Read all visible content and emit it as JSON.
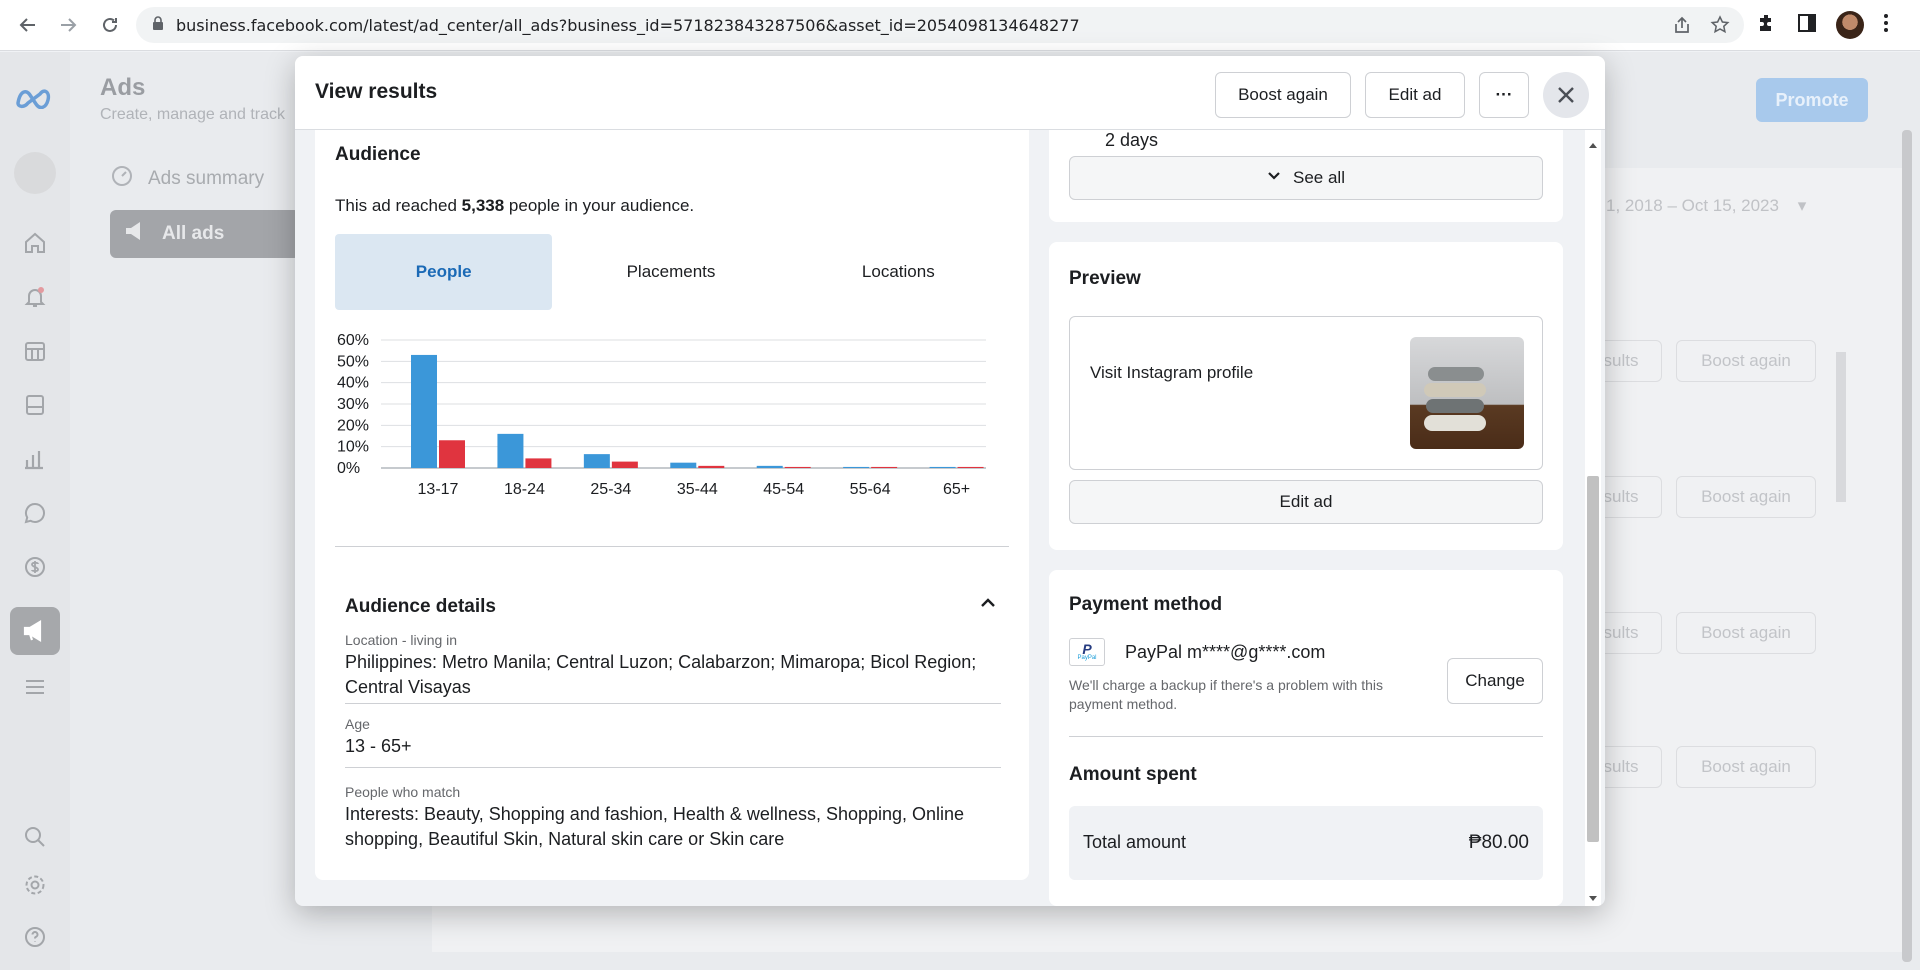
{
  "browser": {
    "url": "business.facebook.com/latest/ad_center/all_ads?business_id=571823843287506&asset_id=2054098134648277"
  },
  "background": {
    "title": "Ads",
    "subtitle": "Create, manage and track",
    "menu": [
      {
        "label": "Ads summary"
      },
      {
        "label": "All ads"
      }
    ],
    "promote_label": "Promote",
    "date_range": "1, 2018 – Oct 15, 2023",
    "row_buttons": [
      "sults",
      "Boost again"
    ]
  },
  "modal": {
    "title": "View results",
    "boost_again": "Boost again",
    "edit_ad": "Edit ad",
    "more": "···",
    "audience": {
      "heading": "Audience",
      "reach_prefix": "This ad reached ",
      "reach_count": "5,338",
      "reach_suffix": " people in your audience.",
      "tabs": [
        "People",
        "Placements",
        "Locations"
      ]
    },
    "details": {
      "heading": "Audience details",
      "location_label": "Location - living in",
      "location_value": "Philippines: Metro Manila; Central Luzon; Calabarzon; Mimaropa; Bicol Region; Central Visayas",
      "age_label": "Age",
      "age_value": "13 - 65+",
      "match_label": "People who match",
      "match_value": "Interests: Beauty, Shopping and fashion, Health & wellness, Shopping, Online shopping, Beautiful Skin, Natural skin care or Skin care"
    },
    "duration_text": "2 days",
    "see_all": "See all",
    "preview": {
      "heading": "Preview",
      "cta": "Visit Instagram profile",
      "edit_ad": "Edit ad"
    },
    "payment": {
      "heading": "Payment method",
      "logo_text": "PayPal",
      "method": "PayPal m****@g****.com",
      "note": "We'll charge a backup if there's a problem with this payment method.",
      "change": "Change"
    },
    "spent": {
      "heading": "Amount spent",
      "label": "Total amount",
      "value": "₱80.00"
    }
  },
  "chart_data": {
    "type": "bar",
    "categories": [
      "13-17",
      "18-24",
      "25-34",
      "35-44",
      "45-54",
      "55-64",
      "65+"
    ],
    "series": [
      {
        "values": [
          53,
          16,
          6.5,
          2.5,
          1,
          0.5,
          0.5
        ],
        "color": "#3b97d9"
      },
      {
        "values": [
          13,
          4.5,
          3,
          1,
          0.5,
          0.5,
          0.5
        ],
        "color": "#e0343f"
      }
    ],
    "yticks": [
      "60%",
      "50%",
      "40%",
      "30%",
      "20%",
      "10%",
      "0%"
    ],
    "ylim": [
      0,
      60
    ],
    "grid": true
  },
  "colors": {
    "accent": "#1b6ab6",
    "tab_active_bg": "#dbe7f2",
    "male_bar": "#3b97d9",
    "female_bar": "#e0343f"
  }
}
